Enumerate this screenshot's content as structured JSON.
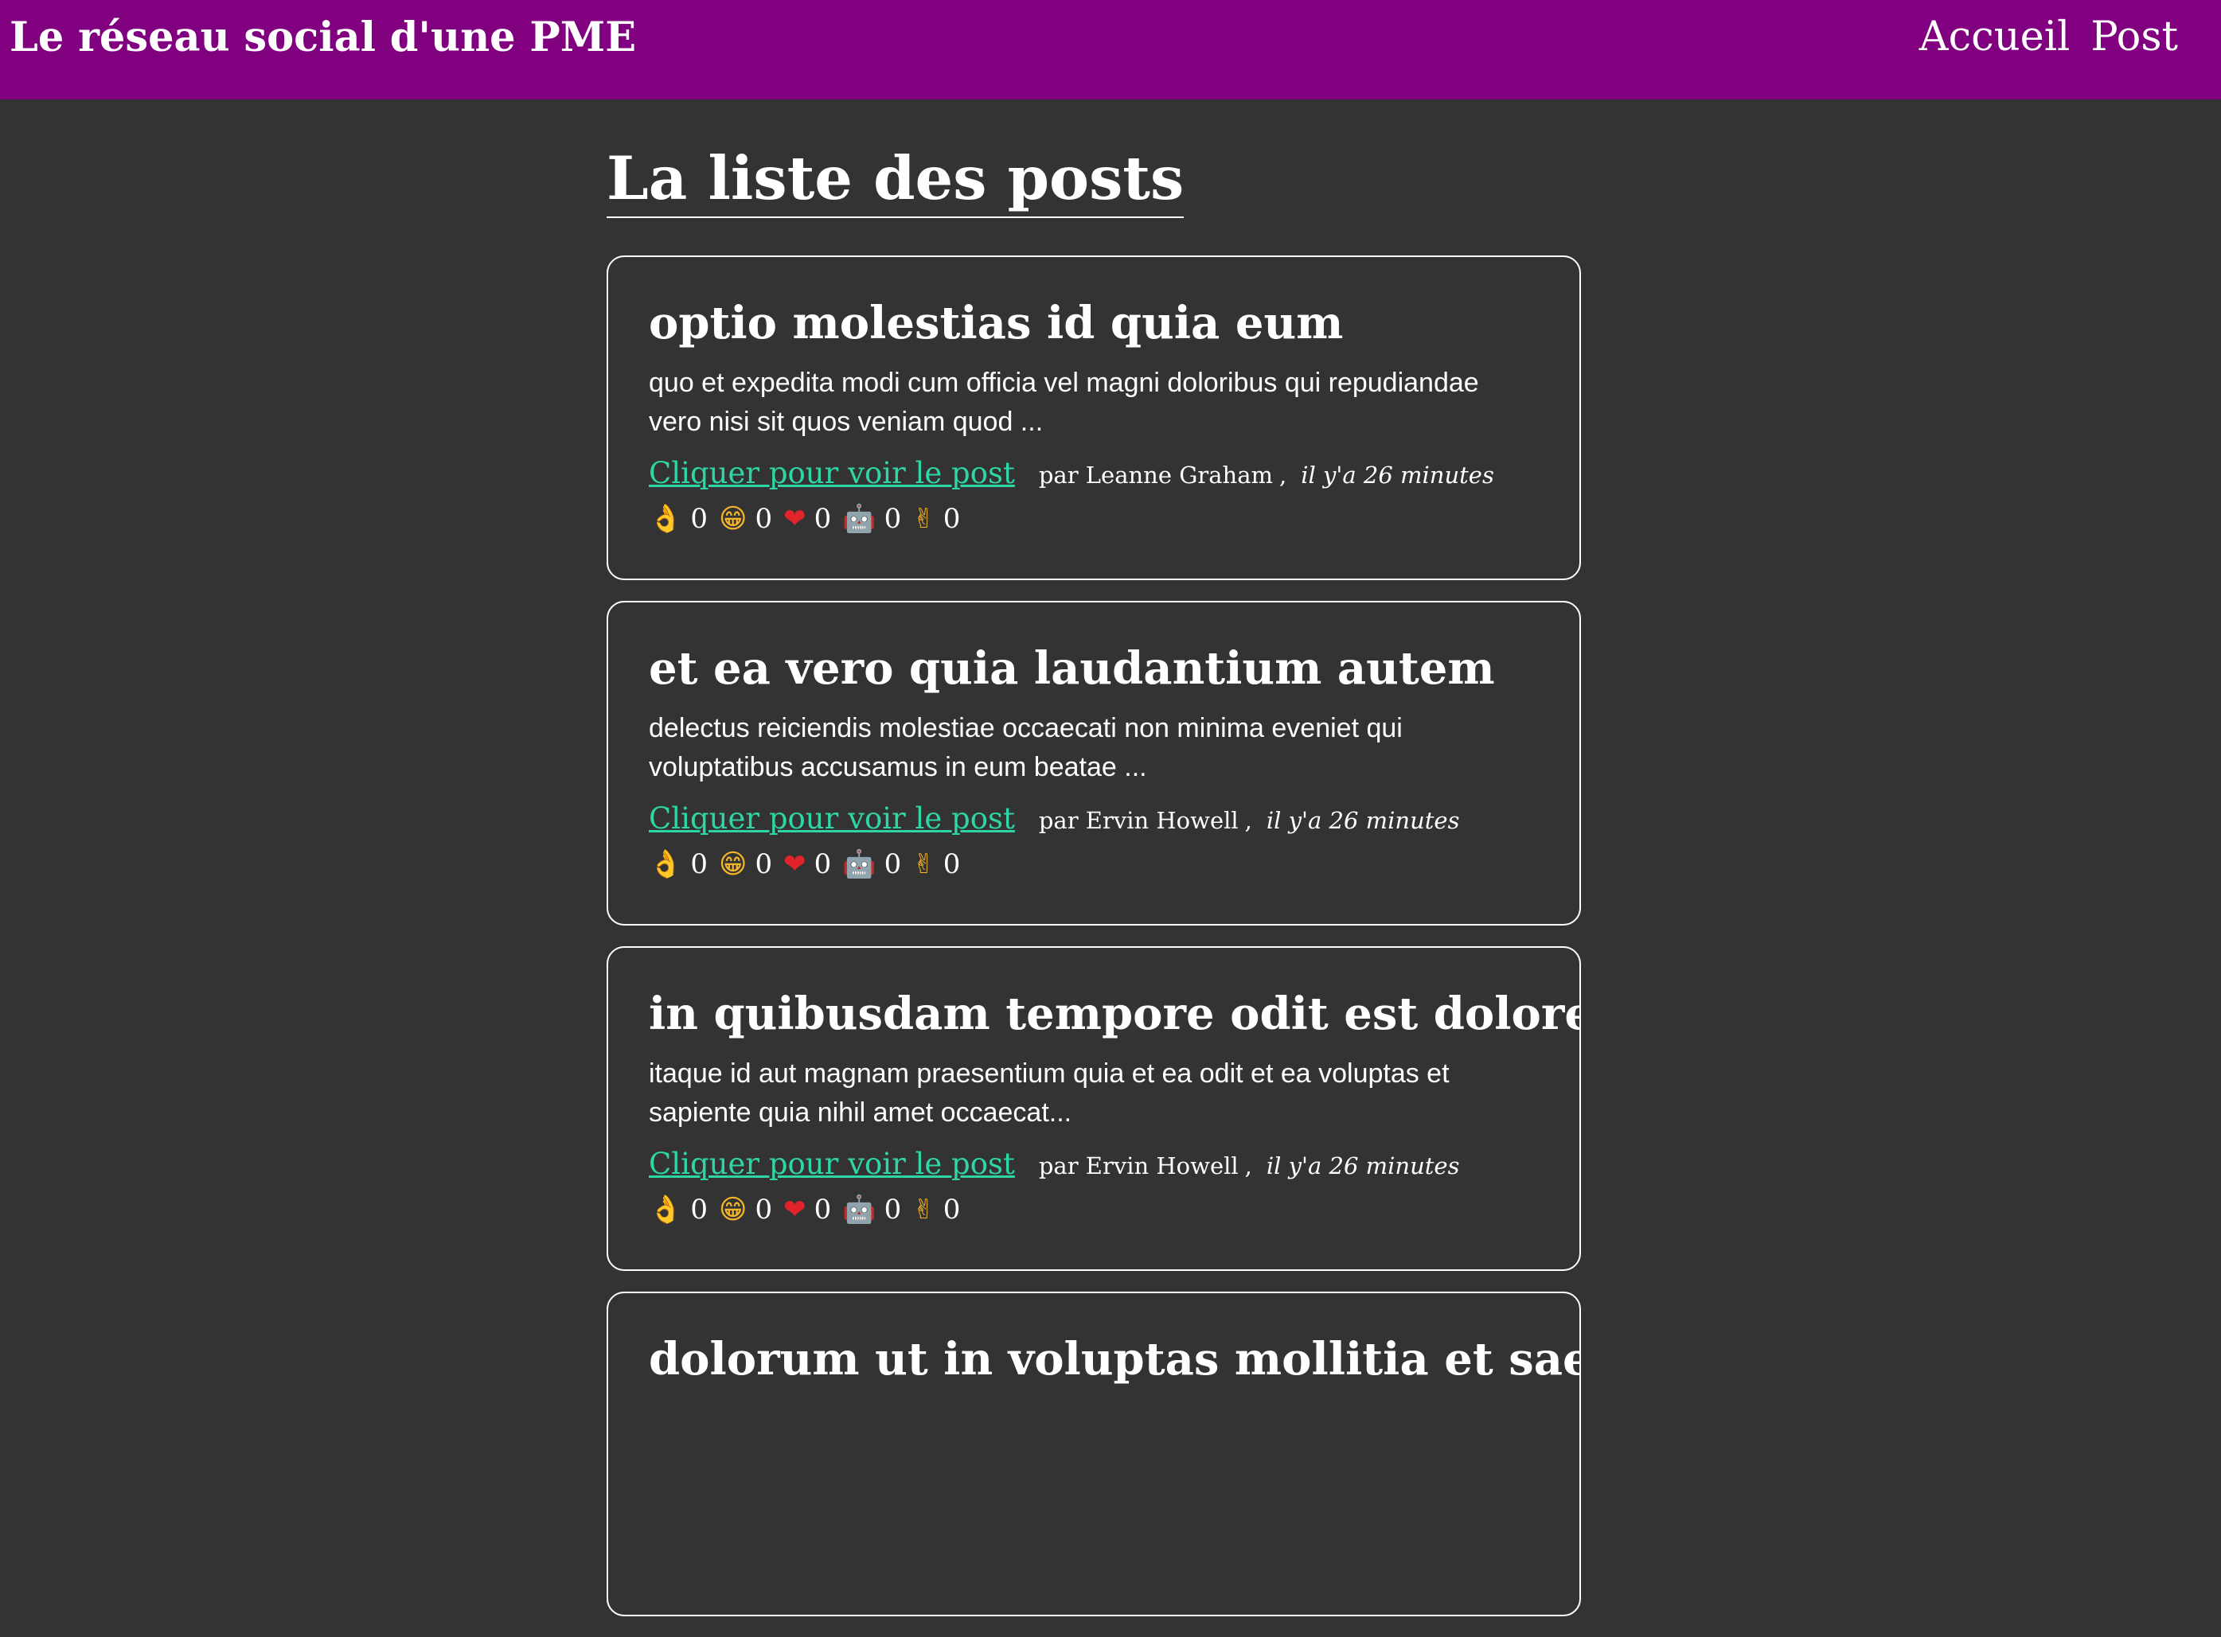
{
  "header": {
    "brand": "Le réseau social d'une PME",
    "nav": [
      {
        "label": "Accueil"
      },
      {
        "label": "Post"
      }
    ]
  },
  "main": {
    "title": "La liste des posts"
  },
  "posts": [
    {
      "title": "optio molestias id quia eum",
      "excerpt": "quo et expedita modi cum officia vel magni doloribus qui repudiandae vero nisi sit quos veniam quod ...",
      "link": "Cliquer pour voir le post",
      "author": "par Leanne Graham",
      "time": "il y'a 26 minutes",
      "reactions": [
        {
          "icon": "ok-hand-icon",
          "glyph": "👌",
          "count": "0"
        },
        {
          "icon": "grin-icon",
          "glyph": "😁",
          "count": "0"
        },
        {
          "icon": "heart-icon",
          "glyph": "❤",
          "count": "0"
        },
        {
          "icon": "robot-icon",
          "glyph": "🤖",
          "count": "0"
        },
        {
          "icon": "peace-icon",
          "glyph": "✌",
          "count": "0"
        }
      ]
    },
    {
      "title": "et ea vero quia laudantium autem",
      "excerpt": "delectus reiciendis molestiae occaecati non minima eveniet qui voluptatibus accusamus in eum beatae ...",
      "link": "Cliquer pour voir le post",
      "author": "par Ervin Howell",
      "time": "il y'a 26 minutes",
      "reactions": [
        {
          "icon": "ok-hand-icon",
          "glyph": "👌",
          "count": "0"
        },
        {
          "icon": "grin-icon",
          "glyph": "😁",
          "count": "0"
        },
        {
          "icon": "heart-icon",
          "glyph": "❤",
          "count": "0"
        },
        {
          "icon": "robot-icon",
          "glyph": "🤖",
          "count": "0"
        },
        {
          "icon": "peace-icon",
          "glyph": "✌",
          "count": "0"
        }
      ]
    },
    {
      "title": "in quibusdam tempore odit est dolorem",
      "excerpt": "itaque id aut magnam praesentium quia et ea odit et ea voluptas et sapiente quia nihil amet occaecat...",
      "link": "Cliquer pour voir le post",
      "author": "par Ervin Howell",
      "time": "il y'a 26 minutes",
      "reactions": [
        {
          "icon": "ok-hand-icon",
          "glyph": "👌",
          "count": "0"
        },
        {
          "icon": "grin-icon",
          "glyph": "😁",
          "count": "0"
        },
        {
          "icon": "heart-icon",
          "glyph": "❤",
          "count": "0"
        },
        {
          "icon": "robot-icon",
          "glyph": "🤖",
          "count": "0"
        },
        {
          "icon": "peace-icon",
          "glyph": "✌",
          "count": "0"
        }
      ]
    },
    {
      "title": "dolorum ut in voluptas mollitia et saepe"
    }
  ],
  "colors": {
    "header_bg": "#800080",
    "page_bg": "#333333",
    "link": "#2ed6a6",
    "text": "#ffffff"
  }
}
